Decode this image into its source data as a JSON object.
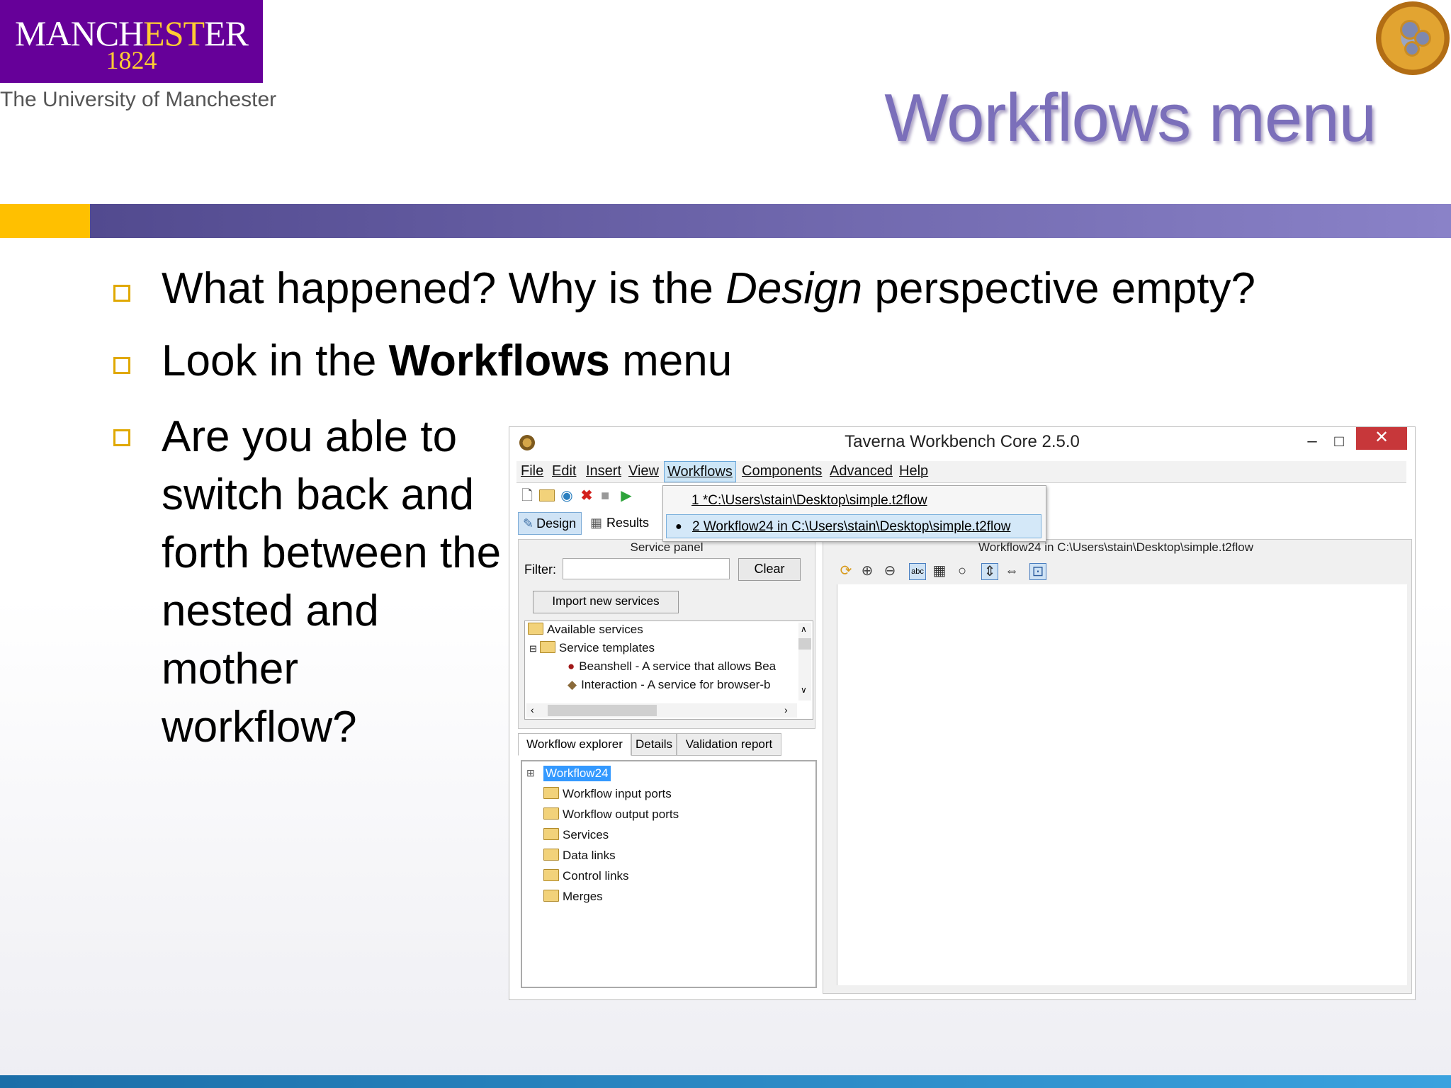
{
  "header": {
    "logo_word_a": "MANCH",
    "logo_word_b": "EST",
    "logo_word_c": "ER",
    "logo_year": "1824",
    "university": "The University of Manchester",
    "title": "Workflows menu"
  },
  "bullets": {
    "b1_pre": "What happened? Why is the ",
    "b1_em": "Design",
    "b1_post": " perspective empty?",
    "b2_pre": "Look in the ",
    "b2_strong": "Workflows",
    "b2_post": " menu",
    "b3": "Are you able to switch back and forth between the nested and mother workflow?"
  },
  "window": {
    "title": "Taverna Workbench Core 2.5.0",
    "min_glyph": "–",
    "max_glyph": "□",
    "close_glyph": "✕",
    "menu": [
      "File",
      "Edit",
      "Insert",
      "View",
      "Workflows",
      "Components",
      "Advanced",
      "Help"
    ],
    "perspectives": {
      "design": "Design",
      "results": "Results"
    },
    "dropdown": {
      "item1": "1 *C:\\Users\\stain\\Desktop\\simple.t2flow",
      "item2": "2 Workflow24 in C:\\Users\\stain\\Desktop\\simple.t2flow",
      "bullet": "●"
    },
    "service_panel": {
      "caption": "Service panel",
      "filter_label": "Filter:",
      "filter_value": "",
      "clear": "Clear",
      "import": "Import new services",
      "tree": [
        "Available services",
        "Service templates",
        "Beanshell - A service that allows Bea",
        "Interaction - A service for browser-b"
      ]
    },
    "explorer": {
      "tabs": [
        "Workflow explorer",
        "Details",
        "Validation report"
      ],
      "root": "Workflow24",
      "items": [
        "Workflow input ports",
        "Workflow output ports",
        "Services",
        "Data links",
        "Control links",
        "Merges"
      ]
    },
    "canvas": {
      "caption": "Workflow24 in C:\\Users\\stain\\Desktop\\simple.t2flow"
    }
  },
  "colors": {
    "logo_purple": "#660099",
    "accent_yellow": "#ffc000",
    "title_purple": "#7b6fba",
    "selection_blue": "#3399ff",
    "close_red": "#c7373a"
  }
}
